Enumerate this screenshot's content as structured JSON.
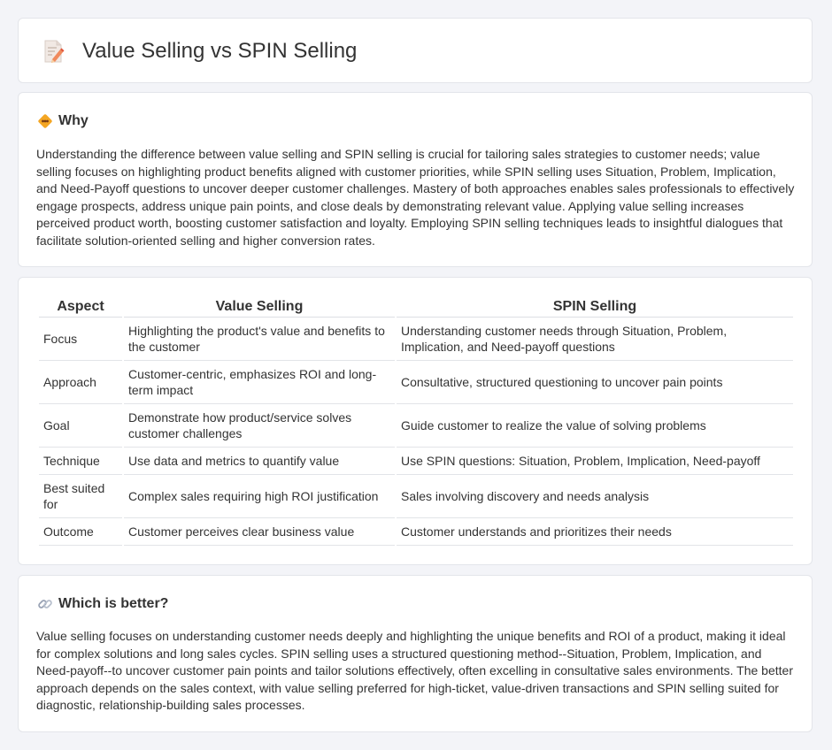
{
  "page": {
    "title": "Value Selling vs SPIN Selling"
  },
  "why": {
    "heading": "Why",
    "text": "Understanding the difference between value selling and SPIN selling is crucial for tailoring sales strategies to customer needs; value selling focuses on highlighting product benefits aligned with customer priorities, while SPIN selling uses Situation, Problem, Implication, and Need-Payoff questions to uncover deeper customer challenges. Mastery of both approaches enables sales professionals to effectively engage prospects, address unique pain points, and close deals by demonstrating relevant value. Applying value selling increases perceived product worth, boosting customer satisfaction and loyalty. Employing SPIN selling techniques leads to insightful dialogues that facilitate solution-oriented selling and higher conversion rates."
  },
  "table": {
    "headers": [
      "Aspect",
      "Value Selling",
      "SPIN Selling"
    ],
    "rows": [
      [
        "Focus",
        "Highlighting the product's value and benefits to the customer",
        "Understanding customer needs through Situation, Problem, Implication, and Need-payoff questions"
      ],
      [
        "Approach",
        "Customer-centric, emphasizes ROI and long-term impact",
        "Consultative, structured questioning to uncover pain points"
      ],
      [
        "Goal",
        "Demonstrate how product/service solves customer challenges",
        "Guide customer to realize the value of solving problems"
      ],
      [
        "Technique",
        "Use data and metrics to quantify value",
        "Use SPIN questions: Situation, Problem, Implication, Need-payoff"
      ],
      [
        "Best suited for",
        "Complex sales requiring high ROI justification",
        "Sales involving discovery and needs analysis"
      ],
      [
        "Outcome",
        "Customer perceives clear business value",
        "Customer understands and prioritizes their needs"
      ]
    ]
  },
  "better": {
    "heading": "Which is better?",
    "text": "Value selling focuses on understanding customer needs deeply and highlighting the unique benefits and ROI of a product, making it ideal for complex solutions and long sales cycles. SPIN selling uses a structured questioning method--Situation, Problem, Implication, and Need-payoff--to uncover customer pain points and tailor solutions effectively, often excelling in consultative sales environments. The better approach depends on the sales context, with value selling preferred for high-ticket, value-driven transactions and SPIN selling suited for diagnostic, relationship-building sales processes."
  },
  "icons": {
    "title": "document-pencil-icon",
    "why": "diamond-sign-icon",
    "better": "link-icon"
  },
  "colors": {
    "background": "#f3f4f8",
    "card": "#ffffff",
    "text": "#333333",
    "border": "#e3e5ea"
  }
}
